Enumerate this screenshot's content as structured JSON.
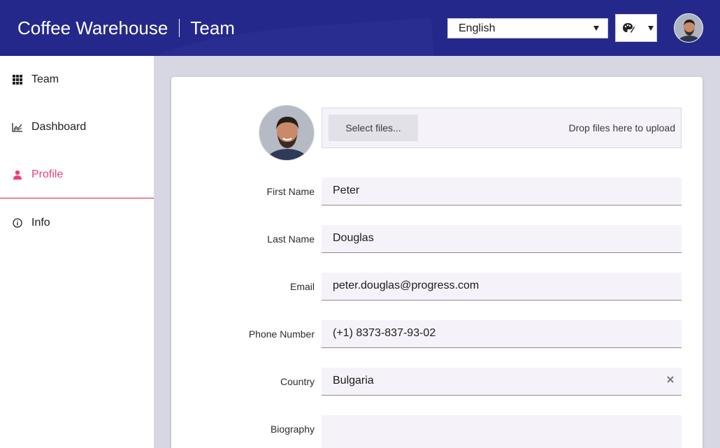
{
  "header": {
    "brand": "Coffee Warehouse",
    "section": "Team",
    "language": {
      "selected": "English"
    },
    "theme_icon": "palette-icon",
    "avatar_icon": "user-avatar"
  },
  "sidebar": {
    "items": [
      {
        "label": "Team",
        "icon": "grid-icon",
        "active": false
      },
      {
        "label": "Dashboard",
        "icon": "chart-icon",
        "active": false
      },
      {
        "label": "Profile",
        "icon": "user-icon",
        "active": true
      },
      {
        "label": "Info",
        "icon": "info-icon",
        "active": false
      }
    ],
    "active_color": "#ee3f79"
  },
  "profile": {
    "upload": {
      "button_label": "Select files...",
      "hint": "Drop files here to upload"
    },
    "fields": {
      "first_name": {
        "label": "First Name",
        "value": "Peter"
      },
      "last_name": {
        "label": "Last Name",
        "value": "Douglas"
      },
      "email": {
        "label": "Email",
        "value": "peter.douglas@progress.com"
      },
      "phone": {
        "label": "Phone Number",
        "value": "(+1) 8373-837-93-02"
      },
      "country": {
        "label": "Country",
        "value": "Bulgaria"
      },
      "biography": {
        "label": "Biography",
        "value": ""
      }
    }
  },
  "colors": {
    "header_bg": "#25288b",
    "page_bg": "#d6d7e3",
    "accent": "#ee3f79"
  }
}
